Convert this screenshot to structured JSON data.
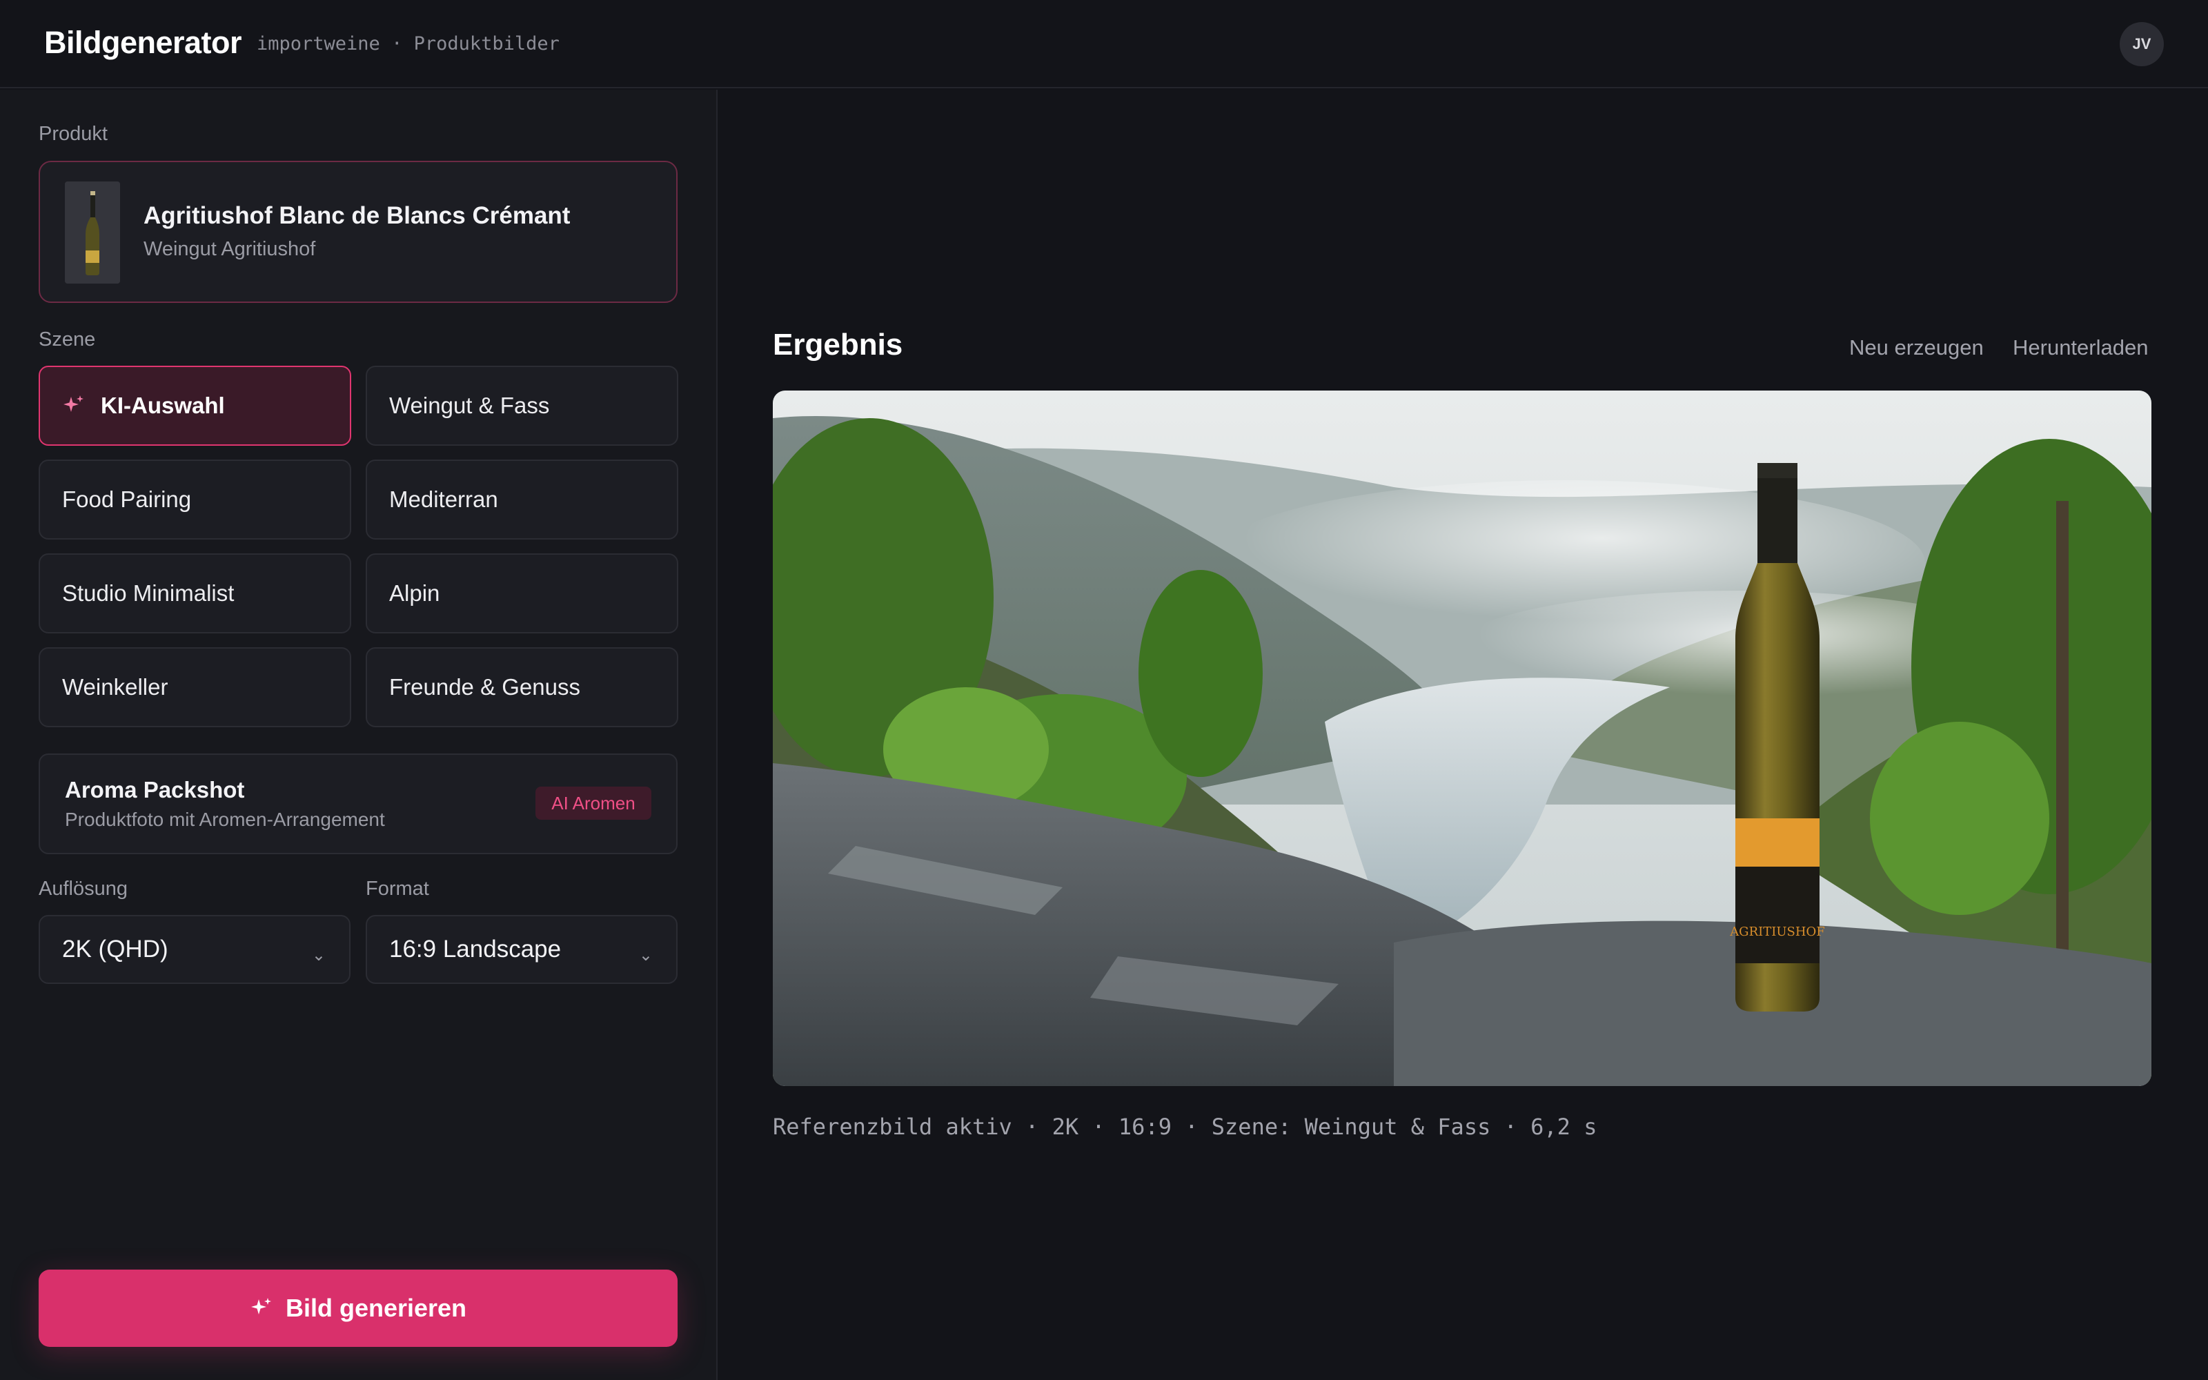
{
  "header": {
    "title": "Bildgenerator",
    "subtitle": "importweine · Produktbilder",
    "avatar_initials": "JV"
  },
  "sidebar": {
    "product_label": "Produkt",
    "product": {
      "name": "Agritiushof Blanc de Blancs Crémant",
      "producer": "Weingut Agritiushof"
    },
    "scene_label": "Szene",
    "scenes": [
      {
        "label": "KI-Auswahl",
        "active": true,
        "icon": "sparkle-icon"
      },
      {
        "label": "Weingut & Fass",
        "active": false
      },
      {
        "label": "Food Pairing",
        "active": false
      },
      {
        "label": "Mediterran",
        "active": false
      },
      {
        "label": "Studio Minimalist",
        "active": false
      },
      {
        "label": "Alpin",
        "active": false
      },
      {
        "label": "Weinkeller",
        "active": false
      },
      {
        "label": "Freunde & Genuss",
        "active": false
      }
    ],
    "aroma": {
      "title": "Aroma Packshot",
      "description": "Produktfoto mit Aromen-Arrangement",
      "badge": "AI Aromen"
    },
    "resolution_label": "Auflösung",
    "resolution_value": "2K (QHD)",
    "format_label": "Format",
    "format_value": "16:9 Landscape",
    "generate_label": "Bild generieren"
  },
  "main": {
    "result_title": "Ergebnis",
    "regenerate_label": "Neu erzeugen",
    "download_label": "Herunterladen",
    "caption": "Referenzbild aktiv · 2K · 16:9 · Szene: Weingut & Fass · 6,2 s",
    "bottle_label": "AGRITIUSHOF"
  },
  "colors": {
    "accent": "#d9306b",
    "background": "#131419",
    "panel": "#17181d"
  }
}
